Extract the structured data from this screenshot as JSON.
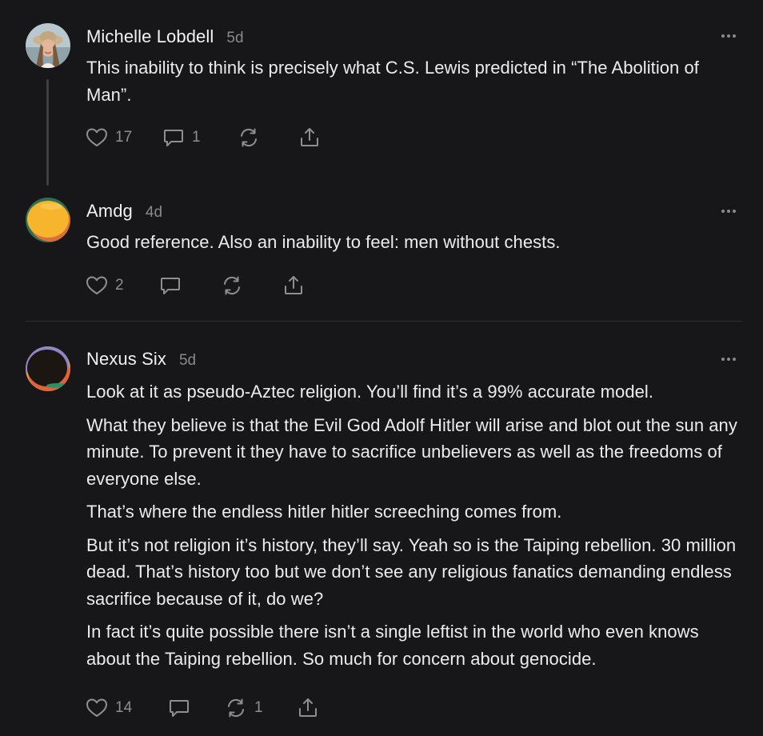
{
  "comments": [
    {
      "author": "Michelle Lobdell",
      "time": "5d",
      "paragraphs": [
        "This inability to think is precisely what C.S. Lewis predicted in “The Abolition of Man”."
      ],
      "likes": "17",
      "replies": "1",
      "restacks": ""
    },
    {
      "author": "Amdg",
      "time": "4d",
      "paragraphs": [
        "Good reference. Also an inability to feel: men without chests."
      ],
      "likes": "2",
      "replies": "",
      "restacks": ""
    },
    {
      "author": "Nexus Six",
      "time": "5d",
      "paragraphs": [
        "Look at it as pseudo-Aztec religion. You’ll find it’s a 99% accurate model.",
        "What they believe is that the Evil God Adolf Hitler will arise and blot out the sun any minute. To prevent it they have to sacrifice unbelievers as well as the freedoms of everyone else.",
        "That’s where the endless hitler hitler screeching comes from.",
        "But it’s not religion it’s history, they’ll say. Yeah so is the Taiping rebellion. 30 million dead. That’s history too but we don’t see any religious fanatics demanding endless sacrifice because of it, do we?",
        "In fact it’s quite possible there isn’t a single leftist in the world who even knows about the Taiping rebellion. So much for concern about genocide."
      ],
      "likes": "14",
      "replies": "",
      "restacks": "1"
    }
  ],
  "icons": {
    "like": "heart-icon",
    "reply": "comment-bubble-icon",
    "restack": "restack-icon",
    "share": "share-icon",
    "more": "more-dots-icon"
  },
  "colors": {
    "background": "#171719",
    "text": "#ececec",
    "muted": "#8e8e93",
    "divider": "#2e2e31"
  }
}
